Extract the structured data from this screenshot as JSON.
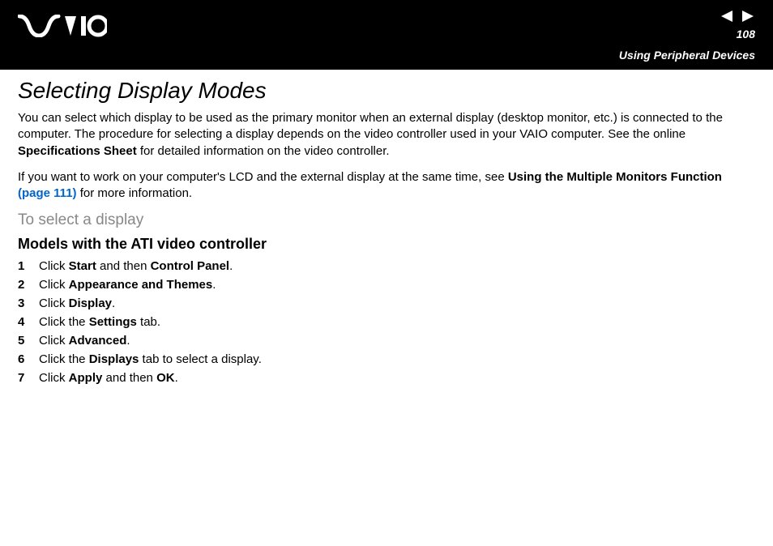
{
  "header": {
    "page_number": "108",
    "section": "Using Peripheral Devices"
  },
  "title": "Selecting Display Modes",
  "para1": {
    "t1": "You can select which display to be used as the primary monitor when an external display (desktop monitor, etc.) is connected to the computer. The procedure for selecting a display depends on the video controller used in your VAIO computer. See the online ",
    "b1": "Specifications Sheet",
    "t2": " for detailed information on the video controller."
  },
  "para2": {
    "t1": "If you want to work on your computer's LCD and the external display at the same time, see ",
    "b1": "Using the Multiple Monitors Function ",
    "link": "(page 111)",
    "t2": " for more information."
  },
  "sub1": "To select a display",
  "sub2": "Models with the ATI video controller",
  "steps": [
    {
      "n": "1",
      "pre": "Click ",
      "b1": "Start",
      "mid": " and then ",
      "b2": "Control Panel",
      "post": "."
    },
    {
      "n": "2",
      "pre": "Click ",
      "b1": "Appearance and Themes",
      "mid": "",
      "b2": "",
      "post": "."
    },
    {
      "n": "3",
      "pre": "Click ",
      "b1": "Display",
      "mid": "",
      "b2": "",
      "post": "."
    },
    {
      "n": "4",
      "pre": "Click the ",
      "b1": "Settings",
      "mid": "",
      "b2": "",
      "post": " tab."
    },
    {
      "n": "5",
      "pre": "Click ",
      "b1": "Advanced",
      "mid": "",
      "b2": "",
      "post": "."
    },
    {
      "n": "6",
      "pre": "Click the ",
      "b1": "Displays",
      "mid": "",
      "b2": "",
      "post": " tab to select a display."
    },
    {
      "n": "7",
      "pre": "Click ",
      "b1": "Apply",
      "mid": " and then ",
      "b2": "OK",
      "post": "."
    }
  ]
}
